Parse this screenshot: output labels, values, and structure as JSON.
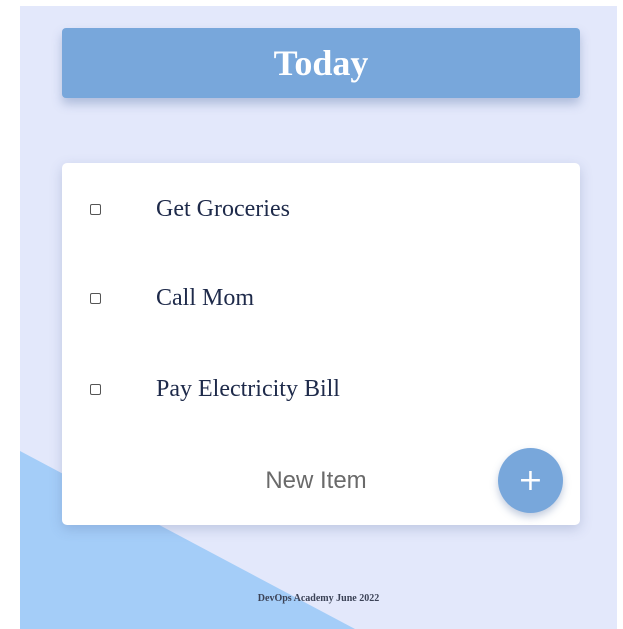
{
  "header": {
    "title": "Today"
  },
  "list": {
    "items": [
      {
        "label": "Get Groceries",
        "checked": false
      },
      {
        "label": "Call Mom",
        "checked": false
      },
      {
        "label": "Pay Electricity Bill",
        "checked": false
      }
    ],
    "new_item_placeholder": "New Item",
    "add_button_label": "+"
  },
  "footer": {
    "text": "DevOps Academy June 2022"
  },
  "colors": {
    "background": "#e3e8fb",
    "accent": "#78a7db",
    "triangle": "#a4cdf8",
    "card": "#ffffff",
    "item_text": "#1e2a4a"
  },
  "icons": {
    "add": "plus-icon",
    "checkbox": "checkbox-unchecked"
  }
}
